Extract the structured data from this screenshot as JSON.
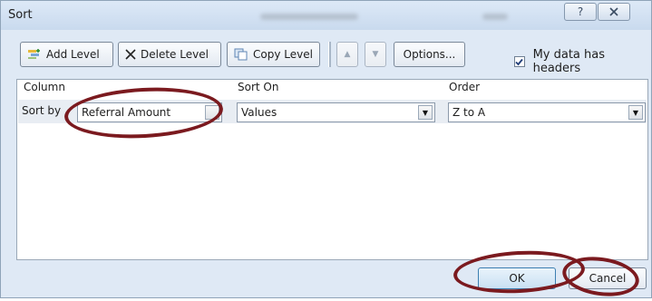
{
  "window": {
    "title": "Sort"
  },
  "toolbar": {
    "add_level": "Add Level",
    "delete_level": "Delete Level",
    "copy_level": "Copy Level",
    "options": "Options...",
    "my_data_has_headers": "My data has headers",
    "headers_checked": true
  },
  "grid": {
    "headers": {
      "column": "Column",
      "sort_on": "Sort On",
      "order": "Order"
    },
    "rows": [
      {
        "label": "Sort by",
        "column": "Referral Amount",
        "sort_on": "Values",
        "order": "Z to A"
      }
    ]
  },
  "footer": {
    "ok": "OK",
    "cancel": "Cancel"
  },
  "annotations": {
    "circle_color": "#7b1a1f"
  },
  "icons": {
    "add": "add-level-icon",
    "delete": "x-icon",
    "copy": "copy-icon"
  }
}
